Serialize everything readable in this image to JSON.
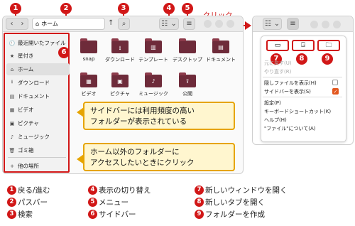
{
  "markers": [
    "1",
    "2",
    "3",
    "4",
    "5",
    "6",
    "7",
    "8",
    "9"
  ],
  "click_label": "クリック",
  "window": {
    "path_icon": "home-icon",
    "path_text": "ホーム",
    "sidebar": [
      {
        "icon": "clock-icon",
        "glyph": "🕘",
        "label": "最近開いたファイル"
      },
      {
        "icon": "star-icon",
        "glyph": "★",
        "label": "星付き"
      },
      {
        "icon": "home-icon",
        "glyph": "⌂",
        "label": "ホーム"
      },
      {
        "icon": "download-icon",
        "glyph": "⭳",
        "label": "ダウンロード"
      },
      {
        "icon": "document-icon",
        "glyph": "▤",
        "label": "ドキュメント"
      },
      {
        "icon": "video-icon",
        "glyph": "▦",
        "label": "ビデオ"
      },
      {
        "icon": "picture-icon",
        "glyph": "▣",
        "label": "ピクチャ"
      },
      {
        "icon": "music-icon",
        "glyph": "♪",
        "label": "ミュージック"
      },
      {
        "icon": "trash-icon",
        "glyph": "🗑",
        "label": "ゴミ箱"
      },
      {
        "icon": "plus-icon",
        "glyph": "+",
        "label": "他の場所"
      }
    ],
    "folders": [
      {
        "label": "snap",
        "glyph": ""
      },
      {
        "label": "ダウンロード",
        "glyph": "⭳"
      },
      {
        "label": "テンプレート",
        "glyph": "▥"
      },
      {
        "label": "デスクトップ",
        "glyph": ""
      },
      {
        "label": "ドキュメント",
        "glyph": "▤"
      },
      {
        "label": "ビデオ",
        "glyph": "▦"
      },
      {
        "label": "ピクチャ",
        "glyph": "▣"
      },
      {
        "label": "ミュージック",
        "glyph": "♪"
      },
      {
        "label": "公開",
        "glyph": "⇪"
      }
    ]
  },
  "callouts": [
    "サイドバーには利用頻度の高い",
    "フォルダーが表示されている",
    "ホーム以外のフォルダーに",
    "アクセスしたいときにクリック"
  ],
  "menu": {
    "undo": "元に戻す(U)",
    "redo": "やり直す(R)",
    "show_hidden": "隠しファイルを表示(H)",
    "show_sidebar": "サイドバーを表示(S)",
    "settings": "設定(P)",
    "shortcuts": "キーボードショートカット(K)",
    "help": "ヘルプ(H)",
    "about": "\"ファイル\"について(A)"
  },
  "legend": [
    {
      "num": "1",
      "text": "戻る/進む"
    },
    {
      "num": "2",
      "text": "パスバー"
    },
    {
      "num": "3",
      "text": "検索"
    },
    {
      "num": "4",
      "text": "表示の切り替え"
    },
    {
      "num": "5",
      "text": "メニュー"
    },
    {
      "num": "6",
      "text": "サイドバー"
    },
    {
      "num": "7",
      "text": "新しいウィンドウを開く"
    },
    {
      "num": "8",
      "text": "新しいタブを開く"
    },
    {
      "num": "9",
      "text": "フォルダーを作成"
    }
  ],
  "colors": {
    "marker": "#d11717",
    "callout_bg": "#fff6cf",
    "callout_border": "#e6a400",
    "folder": "#6e2b3a",
    "check": "#e2571e"
  }
}
